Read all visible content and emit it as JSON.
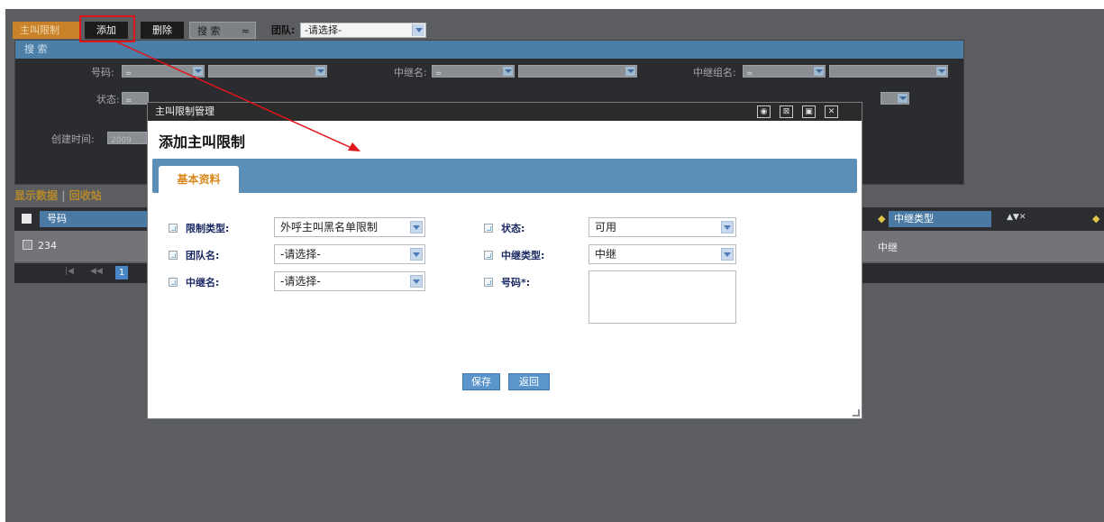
{
  "toolbar": {
    "tab_active": "主叫限制",
    "add_label": "添加",
    "delete_label": "删除",
    "search_label": "搜 索",
    "search_toggle": "≈",
    "team_label": "团队:",
    "team_value": "-请选择-"
  },
  "search_panel": {
    "title": "搜 索",
    "number_label": "号码:",
    "number_op": "=",
    "trunk_name_label": "中继名:",
    "trunk_name_op": "=",
    "trunk_group_label": "中继组名:",
    "trunk_group_op": "=",
    "status_label": "状态:",
    "status_op": "=",
    "created_label": "创建时间:",
    "created_value": "2009"
  },
  "links": {
    "show_data": "显示数据",
    "separator": "|",
    "recycle": "回收站"
  },
  "grid": {
    "col_number": "号码",
    "col_trunk_type": "中继类型",
    "sort_icons": "▲▼✕",
    "row_number": "234",
    "row_trunk_type": "中继",
    "page": "1",
    "pager_first": "|◀",
    "pager_prev": "◀◀"
  },
  "modal": {
    "window_title": "主叫限制管理",
    "heading": "添加主叫限制",
    "tab_basic": "基本资料",
    "fields": {
      "limit_type_label": "限制类型:",
      "limit_type_value": "外呼主叫黑名单限制",
      "status_label": "状态:",
      "status_value": "可用",
      "team_label": "团队名:",
      "team_value": "-请选择-",
      "trunk_type_label": "中继类型:",
      "trunk_type_value": "中继",
      "trunk_name_label": "中继名:",
      "trunk_name_value": "-请选择-",
      "number_label": "号码*:",
      "number_value": ""
    },
    "save_label": "保存",
    "back_label": "返回",
    "window_buttons": [
      "◉",
      "⊠",
      "▣",
      "✕"
    ]
  },
  "colors": {
    "annotation": "#e0141a",
    "accent_blue": "#5b8fb8",
    "tab_orange": "#d9871a"
  }
}
